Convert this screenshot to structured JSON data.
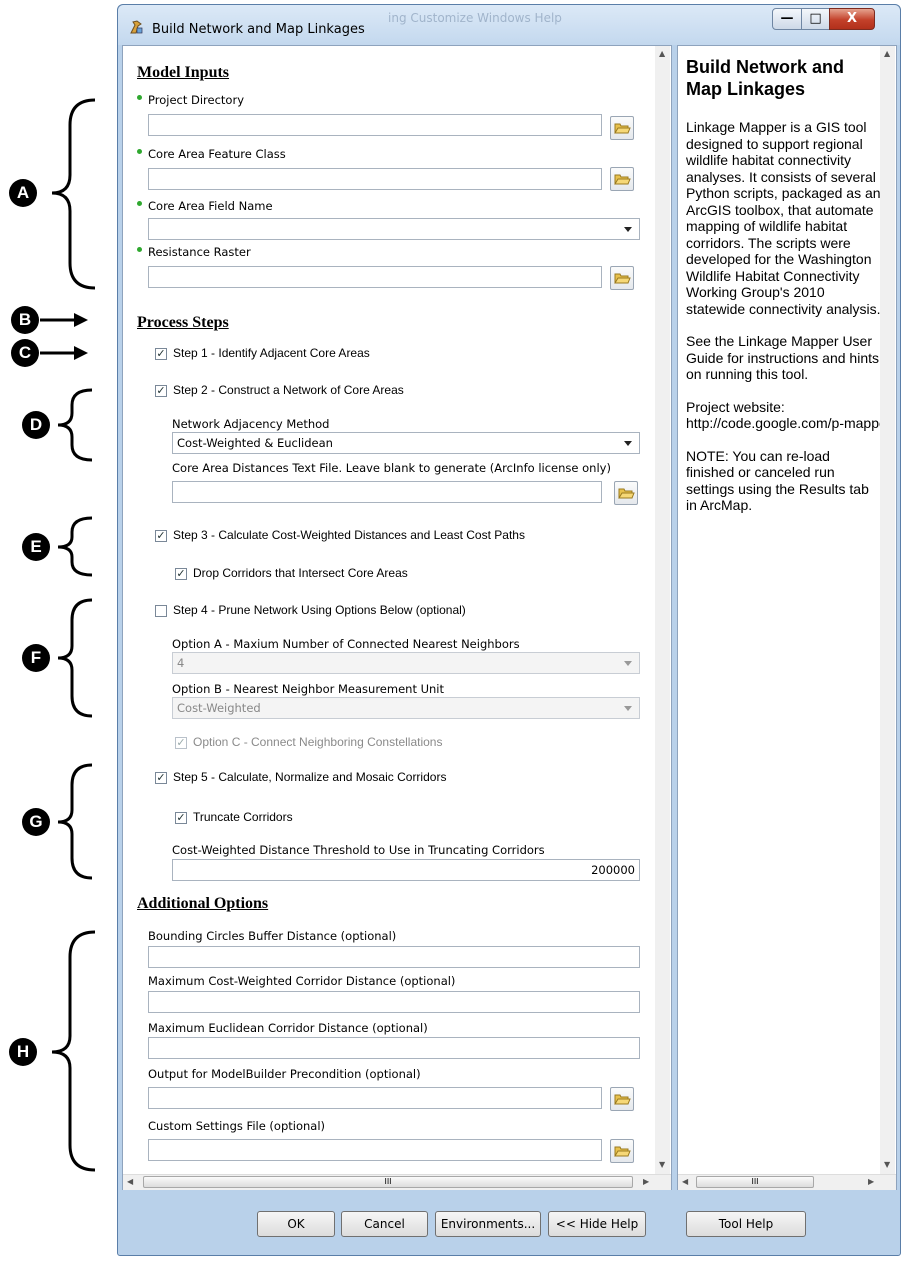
{
  "window": {
    "title": "Build Network and Map Linkages",
    "controls": {
      "minimize": "—",
      "maximize": "□",
      "close": "X"
    },
    "background_menu_text": "ing   Customize   Windows   Help"
  },
  "model_inputs": {
    "heading": "Model Inputs",
    "project_directory": {
      "label": "Project Directory",
      "value": ""
    },
    "core_area_feature_class": {
      "label": "Core Area Feature Class",
      "value": ""
    },
    "core_area_field_name": {
      "label": "Core Area Field Name",
      "value": ""
    },
    "resistance_raster": {
      "label": "Resistance Raster",
      "value": ""
    }
  },
  "process_steps": {
    "heading": "Process Steps",
    "step1": {
      "label": "Step 1 - Identify Adjacent Core Areas",
      "checked": true
    },
    "step2": {
      "label": "Step 2 - Construct a Network of Core Areas",
      "checked": true
    },
    "network_adjacency": {
      "label": "Network Adjacency Method",
      "value": "Cost-Weighted & Euclidean"
    },
    "core_distances_file": {
      "label": "Core Area Distances Text File. Leave blank to generate (ArcInfo license only)",
      "value": ""
    },
    "step3": {
      "label": "Step 3 - Calculate Cost-Weighted Distances and Least Cost Paths",
      "checked": true
    },
    "drop_corridors": {
      "label": "Drop Corridors that Intersect Core Areas",
      "checked": true
    },
    "step4": {
      "label": "Step 4 - Prune Network Using Options Below (optional)",
      "checked": false
    },
    "option_a": {
      "label": "Option A - Maxium Number of Connected Nearest Neighbors",
      "value": "4"
    },
    "option_b": {
      "label": "Option B - Nearest Neighbor Measurement Unit",
      "value": "Cost-Weighted"
    },
    "option_c": {
      "label": "Option C - Connect Neighboring Constellations",
      "checked": true
    },
    "step5": {
      "label": "Step 5 - Calculate, Normalize and Mosaic Corridors",
      "checked": true
    },
    "truncate": {
      "label": "Truncate Corridors",
      "checked": true
    },
    "threshold": {
      "label": "Cost-Weighted Distance Threshold to Use in Truncating Corridors",
      "value": "200000"
    }
  },
  "additional_options": {
    "heading": "Additional Options",
    "bounding_circles": {
      "label": "Bounding Circles Buffer Distance (optional)",
      "value": ""
    },
    "max_cw_distance": {
      "label": "Maximum Cost-Weighted Corridor Distance (optional)",
      "value": ""
    },
    "max_euclid_distance": {
      "label": "Maximum Euclidean Corridor Distance (optional)",
      "value": ""
    },
    "modelbuilder_output": {
      "label": "Output for ModelBuilder Precondition (optional)",
      "value": ""
    },
    "custom_settings": {
      "label": "Custom Settings File (optional)",
      "value": ""
    }
  },
  "help": {
    "title": "Build Network and Map Linkages",
    "p1": "Linkage Mapper is a GIS tool designed to support regional wildlife habitat connectivity analyses. It consists of several Python scripts, packaged as an ArcGIS toolbox, that automate mapping of wildlife habitat corridors. The scripts were developed for the Washington Wildlife Habitat Connectivity Working Group's 2010 statewide connectivity analysis.",
    "p2": "See the Linkage Mapper User Guide for instructions and hints on running this tool.",
    "p3a": "Project website:",
    "p3b": "http://code.google.com/p-mapper/",
    "p4": "NOTE: You can re-load finished or canceled run settings using the Results tab in ArcMap."
  },
  "scrollbars": {
    "grip": "III"
  },
  "buttons": {
    "ok": "OK",
    "cancel": "Cancel",
    "environments": "Environments...",
    "hide_help": "<< Hide Help",
    "tool_help": "Tool Help"
  },
  "annotations": [
    "A",
    "B",
    "C",
    "D",
    "E",
    "F",
    "G",
    "H"
  ],
  "icons": [
    "folder-open-icon",
    "dropdown-arrow-icon",
    "checkbox-icon",
    "arcgis-tool-icon"
  ]
}
